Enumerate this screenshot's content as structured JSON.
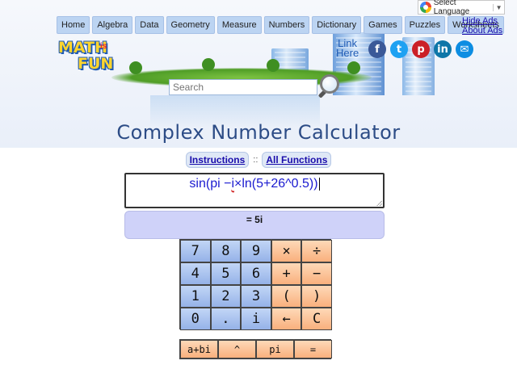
{
  "translate": {
    "label": "Select Language",
    "caret": "▼",
    "icon": "google-icon"
  },
  "nav": [
    "Home",
    "Algebra",
    "Data",
    "Geometry",
    "Measure",
    "Numbers",
    "Dictionary",
    "Games",
    "Puzzles",
    "Worksheets"
  ],
  "ads": {
    "hide": "Hide Ads",
    "about": "About Ads"
  },
  "logo": {
    "line1": "MATH",
    "small": "is",
    "line2": "FUN"
  },
  "search": {
    "placeholder": "Search"
  },
  "link_here": {
    "line1": "Link",
    "line2": "Here"
  },
  "social": [
    {
      "name": "facebook-icon",
      "glyph": "f"
    },
    {
      "name": "twitter-icon",
      "glyph": "t"
    },
    {
      "name": "pinterest-icon",
      "glyph": "p"
    },
    {
      "name": "linkedin-icon",
      "glyph": "in"
    },
    {
      "name": "mail-icon",
      "glyph": "✉"
    }
  ],
  "page_title": "Complex Number Calculator",
  "links": {
    "instructions": "Instructions",
    "separator": "::",
    "all_functions": "All Functions"
  },
  "calculator": {
    "expression_parts": [
      "sin(pi −",
      "i",
      "×ln(5+26^0.5))"
    ],
    "result": "= 5i",
    "keys": [
      [
        "7",
        "8",
        "9",
        "×",
        "÷"
      ],
      [
        "4",
        "5",
        "6",
        "+",
        "−"
      ],
      [
        "1",
        "2",
        "3",
        "(",
        ")"
      ],
      [
        "0",
        ".",
        "i",
        "←",
        "C"
      ]
    ],
    "extra_keys": [
      "a+bi",
      "^",
      "pi",
      "="
    ]
  },
  "colors": {
    "accent": "#1a0dab",
    "result_bg": "#cfd2f9",
    "key_num": "#aac4ef",
    "key_op": "#fbc394",
    "title": "#2c4c86"
  }
}
